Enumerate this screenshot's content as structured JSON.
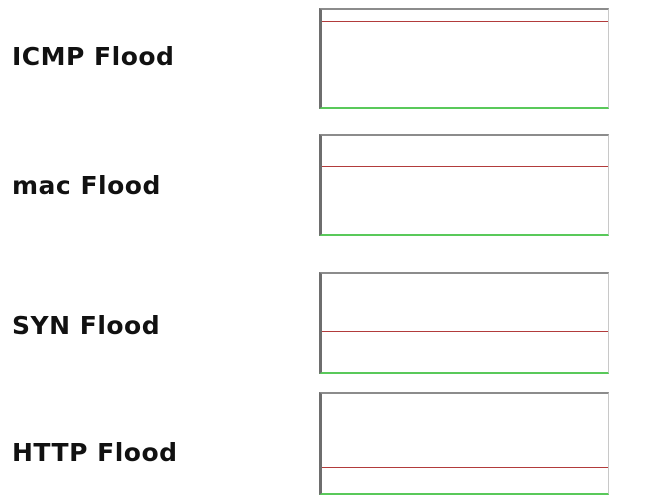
{
  "monitors": [
    {
      "label": "ICMP Flood",
      "level": 0.88
    },
    {
      "label": "mac Flood",
      "level": 0.68
    },
    {
      "label": "SYN Flood",
      "level": 0.41
    },
    {
      "label": "HTTP Flood",
      "level": 0.25
    }
  ],
  "colors": {
    "threshold_line": "#b23b3b",
    "baseline": "#59c95a",
    "frame": "#6e6e6e"
  }
}
